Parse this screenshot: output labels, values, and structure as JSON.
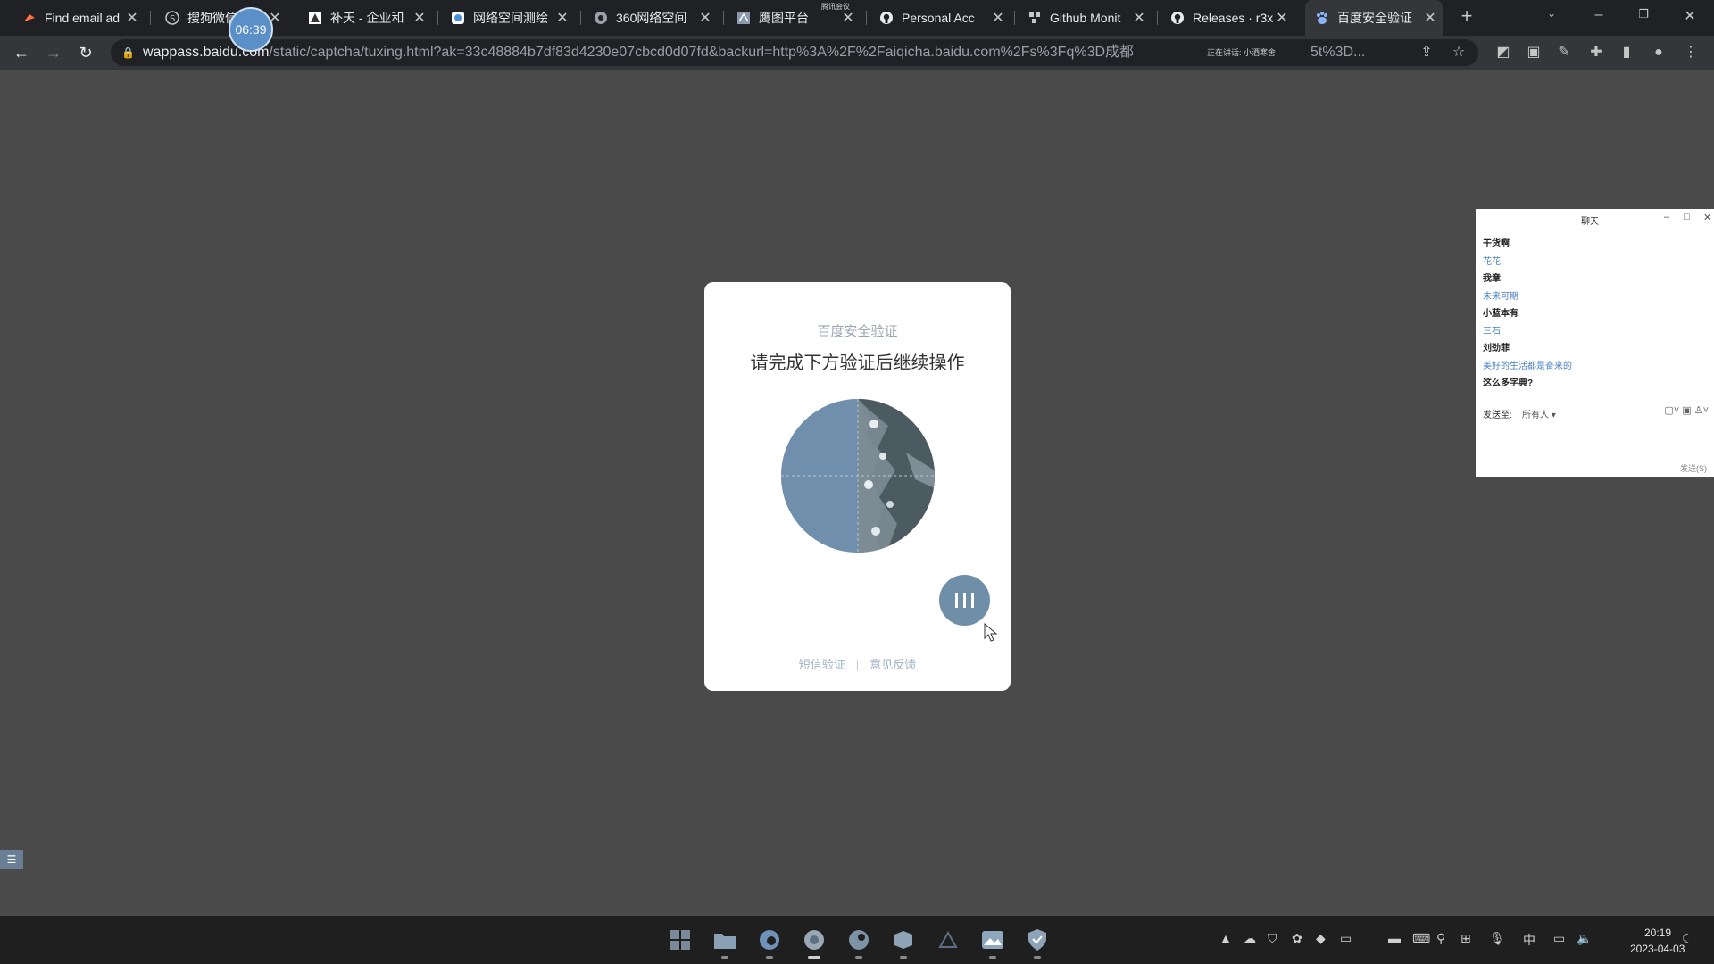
{
  "browser": {
    "tabs": [
      {
        "title": "Find email ad",
        "icon": "hunter-icon"
      },
      {
        "title": "搜狗微信",
        "icon": "sogou-icon"
      },
      {
        "title": "补天 - 企业和",
        "icon": "butian-icon"
      },
      {
        "title": "网络空间测绘",
        "icon": "fofa-icon"
      },
      {
        "title": "360网络空间",
        "icon": "quake-icon"
      },
      {
        "title": "鹰图平台",
        "icon": "hunter-platform-icon"
      },
      {
        "title": "Personal Acc",
        "icon": "github-icon"
      },
      {
        "title": "Github Monit",
        "icon": "monitor-icon"
      },
      {
        "title": "Releases · r3x",
        "icon": "github-icon"
      },
      {
        "title": "百度安全验证",
        "icon": "baidu-icon"
      }
    ],
    "timer": "06:39",
    "meeting_note": "腾讯会议",
    "url_host": "wappass.baidu.com",
    "url_path": "/static/captcha/tuxing.html?ak=33c48884b7df83d4230e07cbcd0d07fd&backurl=http%3A%2F%2Faiqicha.baidu.com%2Fs%3Fq%3D成都",
    "url_tail": "5t%3D...",
    "omnibox_meeting": "正在讲话: 小酒寒舍"
  },
  "captcha": {
    "brand": "百度安全验证",
    "title": "请完成下方验证后继续操作",
    "link_sms": "短信验证",
    "link_feedback": "意见反馈"
  },
  "chat": {
    "title": "聊天",
    "messages": [
      {
        "text": "干货啊",
        "kind": "name"
      },
      {
        "text": "花花",
        "kind": "text"
      },
      {
        "text": "我章",
        "kind": "name"
      },
      {
        "text": "未来可期",
        "kind": "text"
      },
      {
        "text": "小蓝本有",
        "kind": "name"
      },
      {
        "text": "三石",
        "kind": "text"
      },
      {
        "text": "刘劲菲",
        "kind": "name"
      },
      {
        "text": "美好的生活都是奋来的",
        "kind": "text"
      },
      {
        "text": "这么多字典?",
        "kind": "name"
      }
    ],
    "send_to_label": "发送至:",
    "send_to_value": "所有人 ▾",
    "send_button": "发送(S)"
  },
  "taskbar": {
    "ime": "中",
    "time": "20:19",
    "date": "2023-04-03"
  },
  "colors": {
    "page_bg": "#4a4a4a",
    "tab_strip": "#202124",
    "toolbar": "#35363a",
    "slider_button": "#6f8fa9",
    "chat_link": "#4a7fc1"
  }
}
